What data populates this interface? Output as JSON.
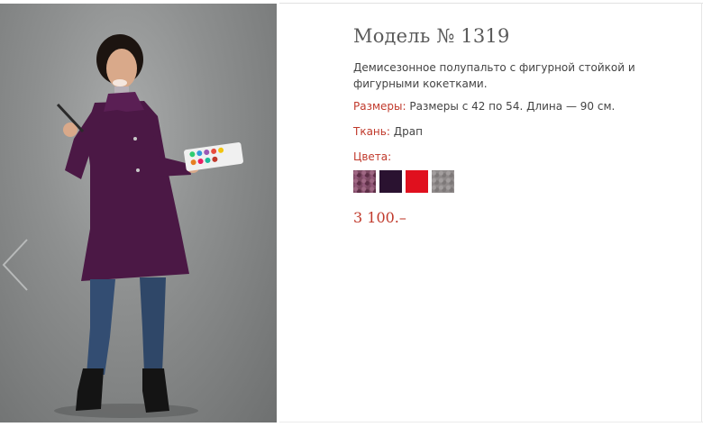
{
  "product": {
    "title": "Модель № 1319",
    "description": "Демисезонное полупальто с фигурной стойкой и фигурными кокетками.",
    "sizes_label": "Размеры:",
    "sizes_value": "Размеры с 42 по 54. Длина — 90 см.",
    "fabric_label": "Ткань:",
    "fabric_value": "Драп",
    "colors_label": "Цвета:",
    "price": "3 100.–"
  },
  "swatches": [
    {
      "name": "mauve-melange",
      "color": "#7d4a63"
    },
    {
      "name": "dark-plum",
      "color": "#2a1230"
    },
    {
      "name": "red",
      "color": "#e0101e"
    },
    {
      "name": "grey",
      "color": "#8f8a8a"
    }
  ],
  "gallery": {
    "prev_icon": "chevron-left-icon"
  }
}
